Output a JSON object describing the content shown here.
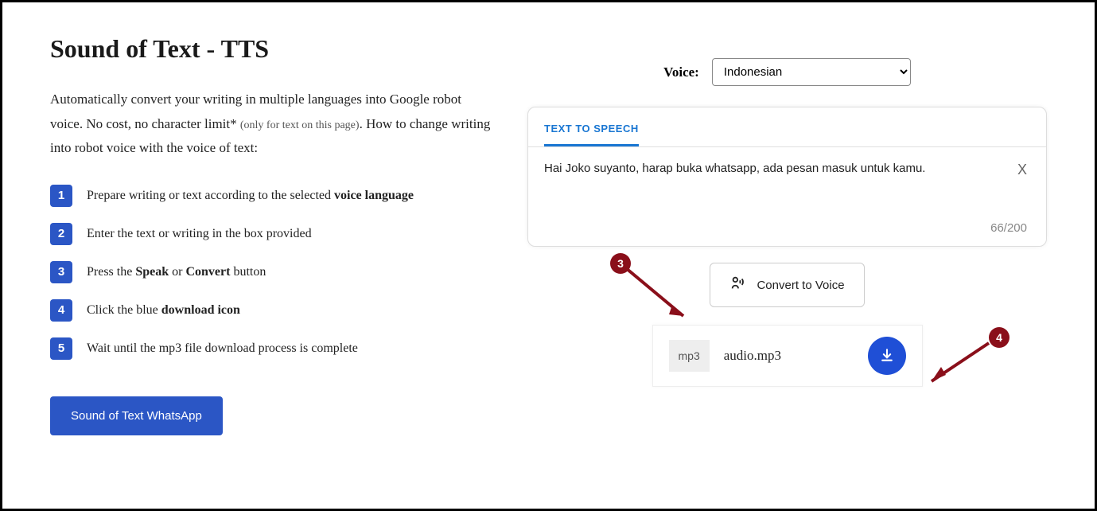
{
  "title": "Sound of Text - TTS",
  "lead_pre": "Automatically convert your writing in multiple languages into Google robot voice. No cost, no character limit* ",
  "lead_small": "(only for text on this page)",
  "lead_post": ". How to change writing into robot voice with the voice of text:",
  "steps": {
    "n1": "1",
    "t1a": "Prepare writing or text according to the selected ",
    "t1b": "voice language",
    "n2": "2",
    "t2": "Enter the text or writing in the box provided",
    "n3": "3",
    "t3a": "Press the ",
    "t3b": "Speak",
    "t3c": " or ",
    "t3d": "Convert",
    "t3e": " button",
    "n4": "4",
    "t4a": "Click the blue ",
    "t4b": "download icon",
    "n5": "5",
    "t5": "Wait until the mp3 file download process is complete"
  },
  "wa_btn": "Sound of Text WhatsApp",
  "voice_label": "Voice:",
  "voice_value": "Indonesian",
  "tab_label": "TEXT TO SPEECH",
  "ta_text": "Hai Joko suyanto, harap buka whatsapp, ada pesan masuk untuk kamu.",
  "clear_x": "X",
  "counter": "66/200",
  "convert_label": "Convert to Voice",
  "badge": "mp3",
  "filename": "audio.mp3",
  "annot3": "3",
  "annot4": "4"
}
